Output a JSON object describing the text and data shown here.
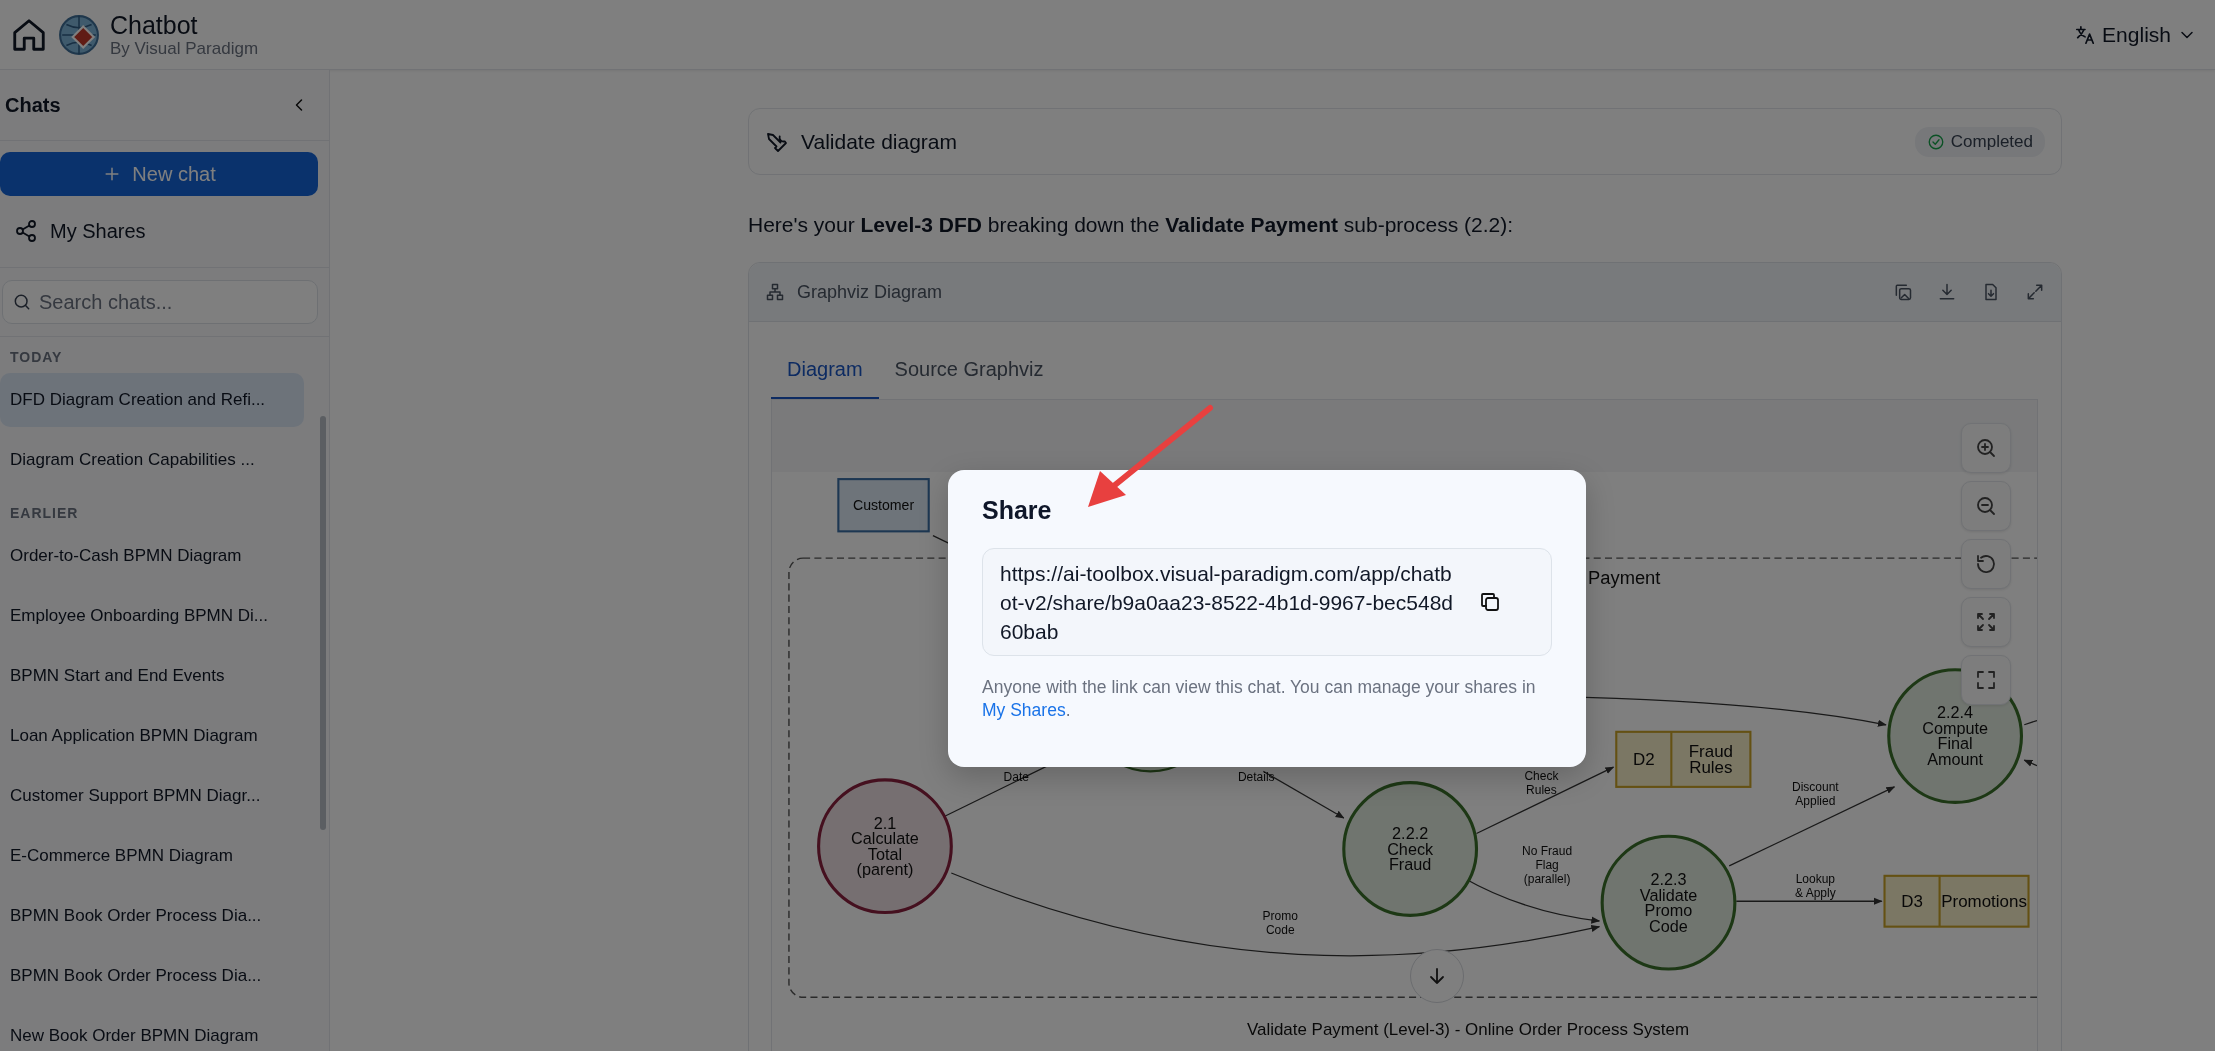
{
  "header": {
    "title": "Chatbot",
    "subtitle": "By Visual Paradigm",
    "language": "English"
  },
  "sidebar": {
    "title": "Chats",
    "new_chat": "New chat",
    "my_shares": "My Shares",
    "search_placeholder": "Search chats...",
    "groups": [
      {
        "label": "TODAY",
        "items": [
          {
            "title": "DFD Diagram Creation and Refi...",
            "selected": true
          },
          {
            "title": "Diagram Creation Capabilities ...",
            "selected": false
          }
        ]
      },
      {
        "label": "EARLIER",
        "items": [
          {
            "title": "Order-to-Cash BPMN Diagram",
            "selected": false
          },
          {
            "title": "Employee Onboarding BPMN Di...",
            "selected": false
          },
          {
            "title": "BPMN Start and End Events",
            "selected": false
          },
          {
            "title": "Loan Application BPMN Diagram",
            "selected": false
          },
          {
            "title": "Customer Support BPMN Diagr...",
            "selected": false
          },
          {
            "title": "E-Commerce BPMN Diagram",
            "selected": false
          },
          {
            "title": "BPMN Book Order Process Dia...",
            "selected": false
          },
          {
            "title": "BPMN Book Order Process Dia...",
            "selected": false
          },
          {
            "title": "New Book Order BPMN Diagram",
            "selected": false
          }
        ]
      }
    ]
  },
  "tool_card": {
    "title": "Validate diagram",
    "status": "Completed"
  },
  "message": "Here's your **Level-3 DFD** breaking down the **Validate Payment** sub-process (2.2):",
  "diagram_card": {
    "title": "Graphviz Diagram",
    "tabs": [
      {
        "label": "Diagram",
        "selected": true
      },
      {
        "label": "Source Graphviz",
        "selected": false
      }
    ],
    "diagram": {
      "entity": "Customer",
      "cluster_label": "Payment",
      "processes": [
        {
          "number": "2.1",
          "name": "Calculate Total (parent)",
          "color": "#45101f"
        },
        {
          "number": "2.2.2",
          "name": "Check Fraud",
          "color": "#1d3815"
        },
        {
          "number": "2.2.3",
          "name": "Validate Promo Code",
          "color": "#1d3815"
        },
        {
          "number": "2.2.4",
          "name": "Compute Final Amount",
          "color": "#1d3815"
        }
      ],
      "stores": [
        {
          "id": "D2",
          "name": "Fraud Rules"
        },
        {
          "id": "D3",
          "name": "Promotions"
        }
      ],
      "flows": [
        {
          "lines": [
            "Date"
          ]
        },
        {
          "lines": [
            "Details"
          ]
        },
        {
          "lines": [
            "Check",
            "Rules"
          ]
        },
        {
          "lines": [
            "No Fraud",
            "Flag",
            "(parallel)"
          ]
        },
        {
          "lines": [
            "Discount",
            "Applied"
          ]
        },
        {
          "lines": [
            "Lookup",
            "& Apply"
          ]
        },
        {
          "lines": [
            "Promo",
            "Code"
          ]
        }
      ],
      "caption": "Validate Payment (Level-3) - Online Order Process System"
    }
  },
  "share_dialog": {
    "title": "Share",
    "url": "https://ai-toolbox.visual-paradigm.com/app/chatbot-v2/share/b9a0aa23-8522-4b1d-9967-bec548d60bab",
    "note": "Anyone with the link can view this chat. You can manage your shares in",
    "link": "My Shares",
    "note_end": "."
  }
}
